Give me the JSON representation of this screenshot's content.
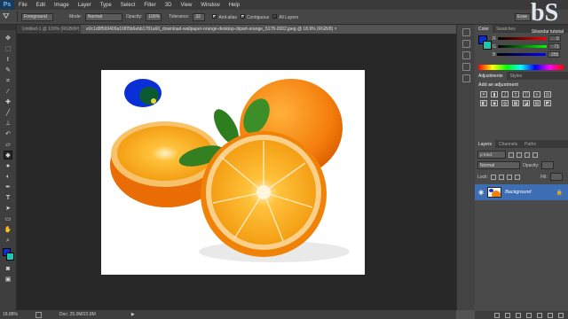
{
  "app": {
    "logo": "Ps"
  },
  "menubar": {
    "items": [
      "File",
      "Edit",
      "Image",
      "Layer",
      "Type",
      "Select",
      "Filter",
      "3D",
      "View",
      "Window",
      "Help"
    ]
  },
  "options": {
    "fill_source": "Foreground",
    "mode_label": "Mode:",
    "mode_value": "Normal",
    "opacity_label": "Opacity:",
    "opacity_value": "100%",
    "tolerance_label": "Tolerance:",
    "tolerance_value": "32",
    "antialias_label": "Anti-alias",
    "contiguous_label": "Contiguous",
    "all_layers_label": "All Layers",
    "workspace": "Esse"
  },
  "tabs": [
    {
      "label": "Untitled-1 @ 100% (RGB/8#) ×"
    },
    {
      "label": "e0c1d9f569409a16f05b6ebb1781a60_download-wallpaper-orange-desktop-clipart-orange_5178-2602.jpeg @ 18.9% (RGB/8) ×"
    }
  ],
  "status": {
    "zoom": "18.88%",
    "doc": "Doc: 25.0M/22.8M"
  },
  "color_panel": {
    "tabs": [
      "Color",
      "Swatches"
    ],
    "values": [
      "0",
      "71",
      "255"
    ],
    "foreground": "#0a2fd6",
    "background": "#1cc7b0"
  },
  "adjustments": {
    "tabs": [
      "Adjustments",
      "Styles"
    ],
    "title": "Add an adjustment"
  },
  "layers": {
    "tabs": [
      "Layers",
      "Channels",
      "Paths"
    ],
    "kind": "ρ Kind",
    "blend": "Normal",
    "opacity_label": "Opacity:",
    "lock_label": "Lock:",
    "fill_label": "Fill:",
    "items": [
      {
        "name": "Background"
      }
    ]
  },
  "watermark": {
    "text": "Sikandar tutorial"
  }
}
